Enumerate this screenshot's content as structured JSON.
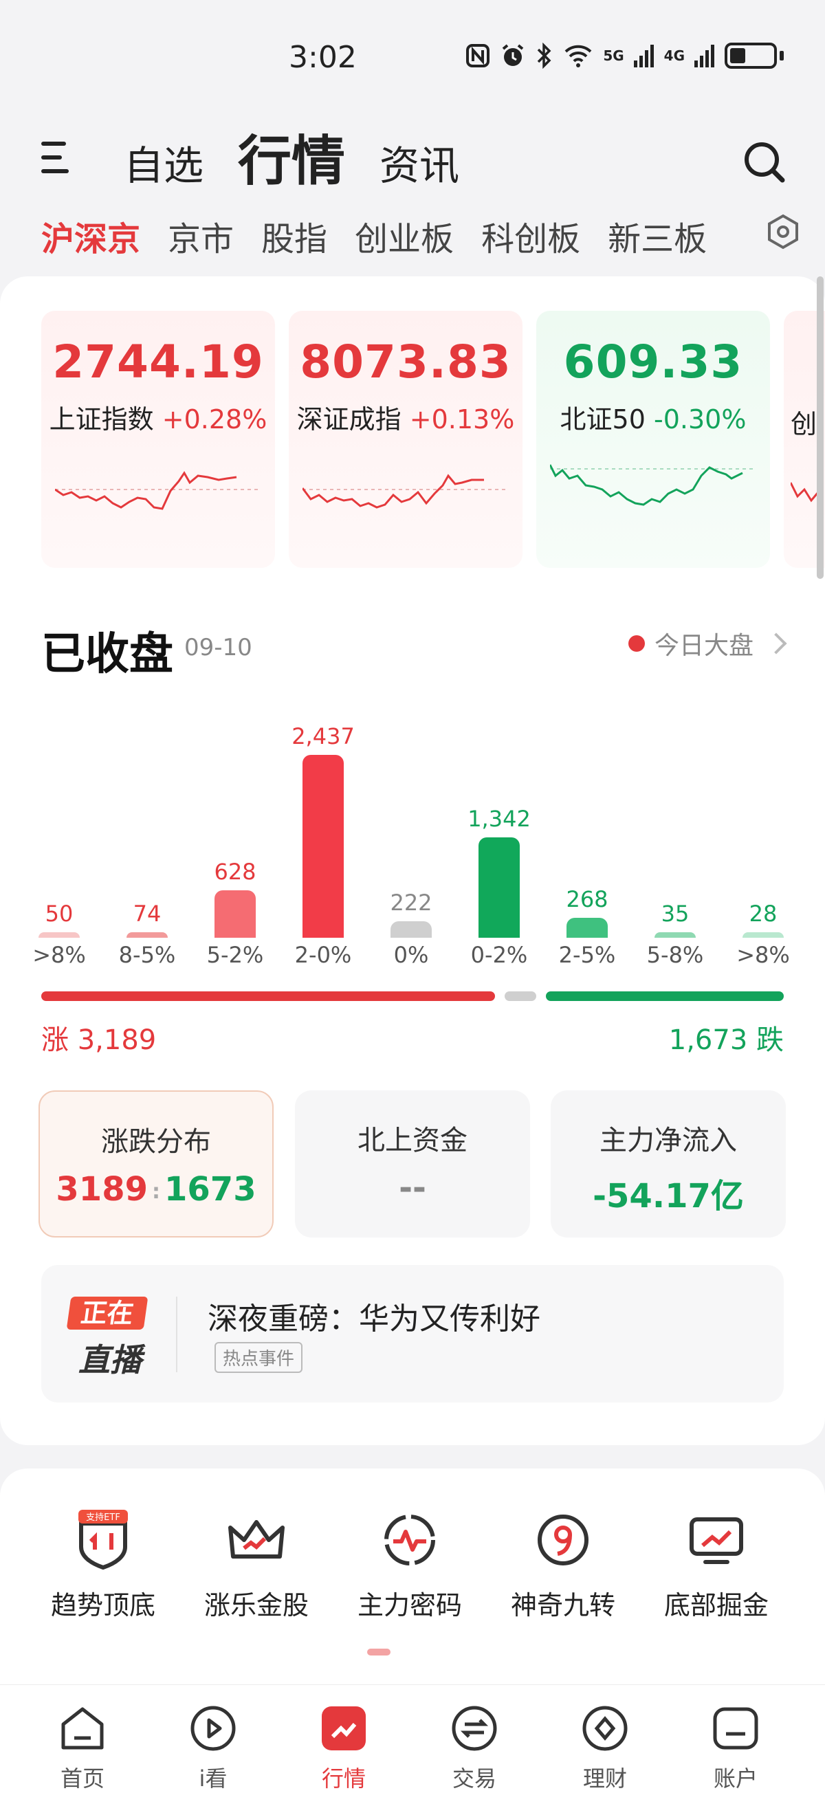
{
  "status": {
    "time": "3:02",
    "net1": "5G",
    "net2": "4G"
  },
  "header": {
    "tabs": [
      {
        "label": "自选",
        "active": false
      },
      {
        "label": "行情",
        "active": true
      },
      {
        "label": "资讯",
        "active": false
      }
    ]
  },
  "market_tabs": [
    "沪深京",
    "京市",
    "股指",
    "创业板",
    "科创板",
    "新三板"
  ],
  "indices": [
    {
      "value": "2744.19",
      "name": "上证指数",
      "change": "+0.28%",
      "direction": "up"
    },
    {
      "value": "8073.83",
      "name": "深证成指",
      "change": "+0.13%",
      "direction": "up"
    },
    {
      "value": "609.33",
      "name": "北证50",
      "change": "-0.30%",
      "direction": "down"
    },
    {
      "value": "",
      "name": "创",
      "change": "",
      "direction": "up"
    }
  ],
  "market_status": {
    "title": "已收盘",
    "date": "09-10",
    "today_link": "今日大盘"
  },
  "chart_data": {
    "type": "bar",
    "categories": [
      ">8%",
      "8-5%",
      "5-2%",
      "2-0%",
      "0%",
      "0-2%",
      "2-5%",
      "5-8%",
      ">8%"
    ],
    "values": [
      50,
      74,
      628,
      2437,
      222,
      1342,
      268,
      35,
      28
    ],
    "value_labels": [
      "50",
      "74",
      "628",
      "2,437",
      "222",
      "1,342",
      "268",
      "35",
      "28"
    ],
    "colors": [
      "#f7c6c6",
      "#f29a9a",
      "#f56c72",
      "#f23c48",
      "#cfcfcf",
      "#11a85a",
      "#3fc17f",
      "#8fd9b2",
      "#b9e8cf"
    ],
    "label_colors": [
      "#e4393c",
      "#e4393c",
      "#e4393c",
      "#e4393c",
      "#888888",
      "#13a35b",
      "#13a35b",
      "#13a35b",
      "#13a35b"
    ]
  },
  "breadth": {
    "rise_label": "涨 3,189",
    "fall_label": "1,673 跌",
    "rise": 3189,
    "flat": 222,
    "fall": 1673
  },
  "stats": {
    "distribution": {
      "title": "涨跌分布",
      "up": "3189",
      "down": "1673"
    },
    "northbound": {
      "title": "北上资金",
      "value": "--"
    },
    "main_flow": {
      "title": "主力净流入",
      "value": "-54.17亿"
    }
  },
  "live": {
    "badge_top": "正在",
    "badge_bottom": "直播",
    "title": "深夜重磅：华为又传利好",
    "tag": "热点事件"
  },
  "tools": [
    {
      "label": "趋势顶底",
      "badge": "支持ETF",
      "icon": "trend-shield-icon"
    },
    {
      "label": "涨乐金股",
      "icon": "crown-icon"
    },
    {
      "label": "主力密码",
      "icon": "pulse-ring-icon"
    },
    {
      "label": "神奇九转",
      "icon": "nine-icon"
    },
    {
      "label": "底部掘金",
      "icon": "monitor-chart-icon"
    }
  ],
  "bottom_nav": [
    {
      "label": "首页",
      "icon": "home-icon",
      "active": false
    },
    {
      "label": "i看",
      "icon": "play-icon",
      "active": false
    },
    {
      "label": "行情",
      "icon": "market-icon",
      "active": true
    },
    {
      "label": "交易",
      "icon": "trade-icon",
      "active": false
    },
    {
      "label": "理财",
      "icon": "wealth-icon",
      "active": false
    },
    {
      "label": "账户",
      "icon": "account-icon",
      "active": false
    }
  ],
  "colors": {
    "up": "#e4393c",
    "down": "#13a35b",
    "flat": "#cfcfcf"
  }
}
